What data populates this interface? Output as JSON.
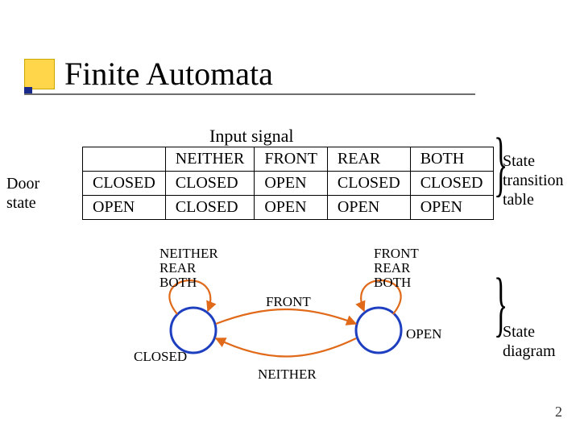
{
  "title": "Finite Automata",
  "table": {
    "input_heading": "Input signal",
    "row_heading": "Door state",
    "columns": [
      "NEITHER",
      "FRONT",
      "REAR",
      "BOTH"
    ],
    "rows": [
      {
        "state": "CLOSED",
        "cells": [
          "CLOSED",
          "OPEN",
          "CLOSED",
          "CLOSED"
        ]
      },
      {
        "state": "OPEN",
        "cells": [
          "CLOSED",
          "OPEN",
          "OPEN",
          "OPEN"
        ]
      }
    ]
  },
  "annotations": {
    "table_label": "State transition table",
    "diagram_label": "State diagram"
  },
  "diagram": {
    "states": [
      "CLOSED",
      "OPEN"
    ],
    "self_loops": {
      "CLOSED": [
        "NEITHER",
        "REAR",
        "BOTH"
      ],
      "OPEN": [
        "FRONT",
        "REAR",
        "BOTH"
      ]
    },
    "transitions": [
      {
        "from": "CLOSED",
        "to": "OPEN",
        "label": "FRONT"
      },
      {
        "from": "OPEN",
        "to": "CLOSED",
        "label": "NEITHER"
      }
    ]
  },
  "slide_number": "2",
  "chart_data": {
    "type": "table",
    "title": "State transition table",
    "rows_axis": "Door state",
    "cols_axis": "Input signal",
    "row_labels": [
      "CLOSED",
      "OPEN"
    ],
    "col_labels": [
      "NEITHER",
      "FRONT",
      "REAR",
      "BOTH"
    ],
    "cells": [
      [
        "CLOSED",
        "OPEN",
        "CLOSED",
        "CLOSED"
      ],
      [
        "CLOSED",
        "OPEN",
        "OPEN",
        "OPEN"
      ]
    ]
  }
}
